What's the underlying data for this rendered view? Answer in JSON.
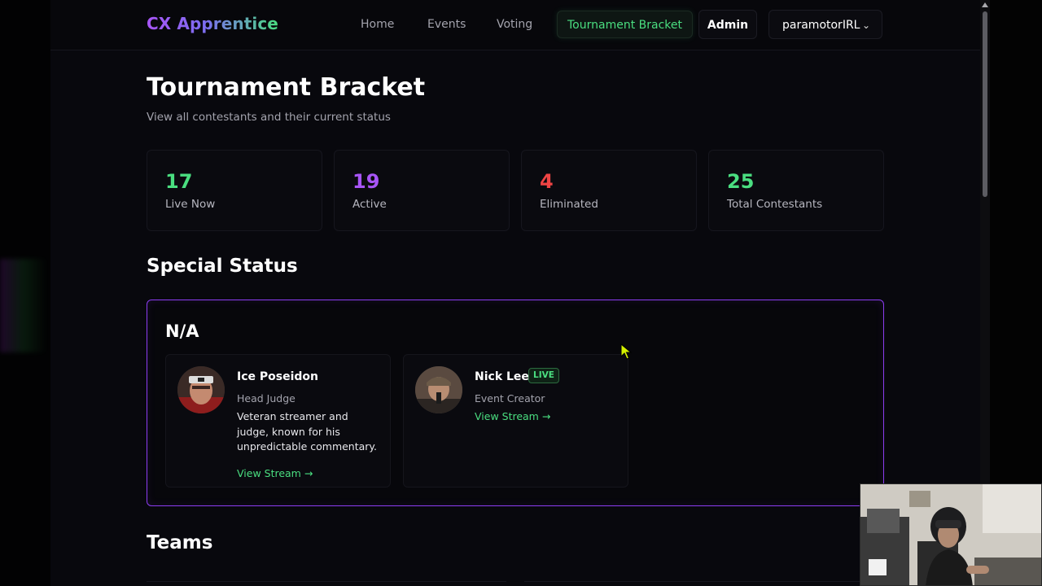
{
  "app": {
    "logo": "CX Apprentice"
  },
  "nav": {
    "home": "Home",
    "events": "Events",
    "voting": "Voting",
    "bracket": "Tournament Bracket",
    "admin": "Admin",
    "user": "paramotorIRL"
  },
  "page": {
    "title": "Tournament Bracket",
    "subtitle": "View all contestants and their current status"
  },
  "stats": [
    {
      "value": "17",
      "label": "Live Now",
      "color": "#4ade80"
    },
    {
      "value": "19",
      "label": "Active",
      "color": "#a855f7"
    },
    {
      "value": "4",
      "label": "Eliminated",
      "color": "#ef4444"
    },
    {
      "value": "25",
      "label": "Total Contestants",
      "color": "#4ade80"
    }
  ],
  "special_status": {
    "section_title": "Special Status",
    "group_title": "N/A",
    "people": [
      {
        "name": "Ice Poseidon",
        "role": "Head Judge",
        "bio": "Veteran streamer and judge, known for his unpredictable commentary.",
        "link": "View Stream →",
        "live": ""
      },
      {
        "name": "Nick Lee",
        "role": "Event Creator",
        "bio": "",
        "link": "View Stream →",
        "live": "LIVE"
      }
    ]
  },
  "teams": {
    "section_title": "Teams"
  },
  "colors": {
    "accent_green": "#4ade80",
    "accent_purple": "#a855f7",
    "danger_red": "#ef4444",
    "panel_border": "#8b3cf0"
  }
}
